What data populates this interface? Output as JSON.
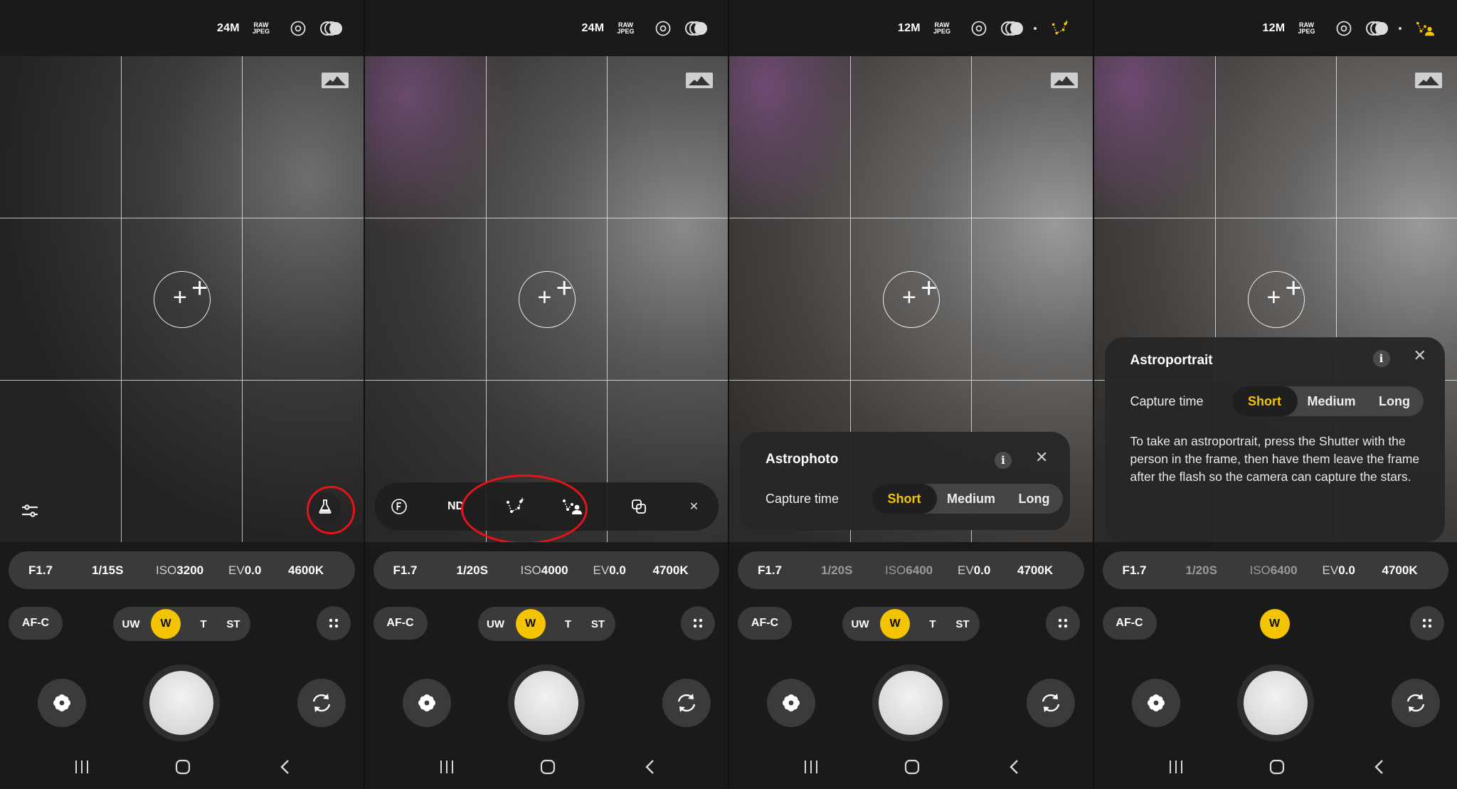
{
  "panels": [
    {
      "topbar": {
        "resolution": "24M",
        "format_top": "RAW",
        "format_bottom": "JPEG"
      },
      "params": {
        "aperture": "F1.7",
        "shutter": "1/15S",
        "iso_label": "ISO",
        "iso_value": "3200",
        "ev_label": "EV",
        "ev_value": "0.0",
        "wb": "4600K"
      },
      "focus_mode": "AF-C",
      "lenses": [
        "UW",
        "W",
        "T",
        "ST"
      ],
      "selected_lens": "W"
    },
    {
      "topbar": {
        "resolution": "24M",
        "format_top": "RAW",
        "format_bottom": "JPEG"
      },
      "lab_bar": {
        "nd_label": "ND"
      },
      "params": {
        "aperture": "F1.7",
        "shutter": "1/20S",
        "iso_label": "ISO",
        "iso_value": "4000",
        "ev_label": "EV",
        "ev_value": "0.0",
        "wb": "4700K"
      },
      "focus_mode": "AF-C",
      "lenses": [
        "UW",
        "W",
        "T",
        "ST"
      ],
      "selected_lens": "W"
    },
    {
      "topbar": {
        "resolution": "12M",
        "format_top": "RAW",
        "format_bottom": "JPEG"
      },
      "popup": {
        "title": "Astrophoto",
        "capture_label": "Capture time",
        "options": [
          "Short",
          "Medium",
          "Long"
        ],
        "selected": "Short"
      },
      "params": {
        "aperture": "F1.7",
        "shutter": "1/20S",
        "iso_label": "ISO",
        "iso_value": "6400",
        "ev_label": "EV",
        "ev_value": "0.0",
        "wb": "4700K"
      },
      "focus_mode": "AF-C",
      "lenses": [
        "UW",
        "W",
        "T",
        "ST"
      ],
      "selected_lens": "W"
    },
    {
      "topbar": {
        "resolution": "12M",
        "format_top": "RAW",
        "format_bottom": "JPEG"
      },
      "popup": {
        "title": "Astroportrait",
        "capture_label": "Capture time",
        "options": [
          "Short",
          "Medium",
          "Long"
        ],
        "selected": "Short",
        "description": "To take an astroportrait, press the Shutter with the person in the frame, then have them leave the frame after the flash so the camera can capture the stars."
      },
      "params": {
        "aperture": "F1.7",
        "shutter": "1/20S",
        "iso_label": "ISO",
        "iso_value": "6400",
        "ev_label": "EV",
        "ev_value": "0.0",
        "wb": "4700K"
      },
      "focus_mode": "AF-C",
      "selected_lens": "W"
    }
  ],
  "info_glyph": "i",
  "close_glyph": "✕",
  "colors": {
    "accent": "#f5c400",
    "highlight_ring": "#e8121b",
    "panel_bg": "#1a1a1a",
    "pill_bg": "#3a3a3a"
  },
  "icons": [
    "resolution-label",
    "raw-jpeg-badge",
    "lens-target-icon",
    "hdr-rings-icon",
    "astrophoto-icon",
    "astroportrait-icon",
    "histogram-icon",
    "settings-sliders-icon",
    "lab-flask-icon",
    "f-circle-icon",
    "overlay-squares-icon",
    "grid-dots-icon",
    "flower-icon",
    "flip-camera-icon",
    "recent-apps-icon",
    "home-icon",
    "back-icon"
  ]
}
